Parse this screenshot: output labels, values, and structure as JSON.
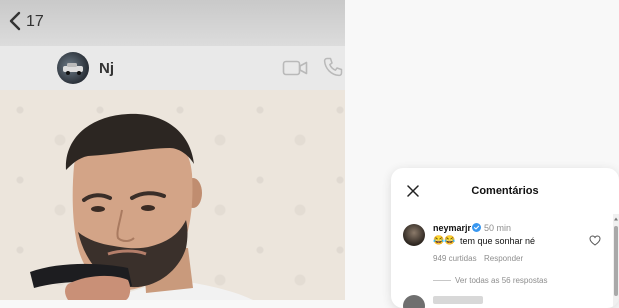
{
  "chat": {
    "unread_count": "17",
    "contact_name": "Nj"
  },
  "icons": {
    "back": "chevron-left-icon",
    "video": "video-camera-icon",
    "phone": "phone-icon",
    "close": "close-icon",
    "verified": "verified-badge-icon",
    "heart": "heart-icon"
  },
  "comments_panel": {
    "title": "Comentários",
    "comment": {
      "user": "neymarjr",
      "time": "50 min",
      "emojis": "😂😂",
      "text": "tem que sonhar né",
      "likes": "949 curtidas",
      "reply_label": "Responder",
      "view_replies": "Ver todas as 56 respostas"
    }
  },
  "colors": {
    "verified_blue": "#3897f0",
    "secondary_text": "#8e8e8e",
    "chat_background": "#ece5dc"
  }
}
